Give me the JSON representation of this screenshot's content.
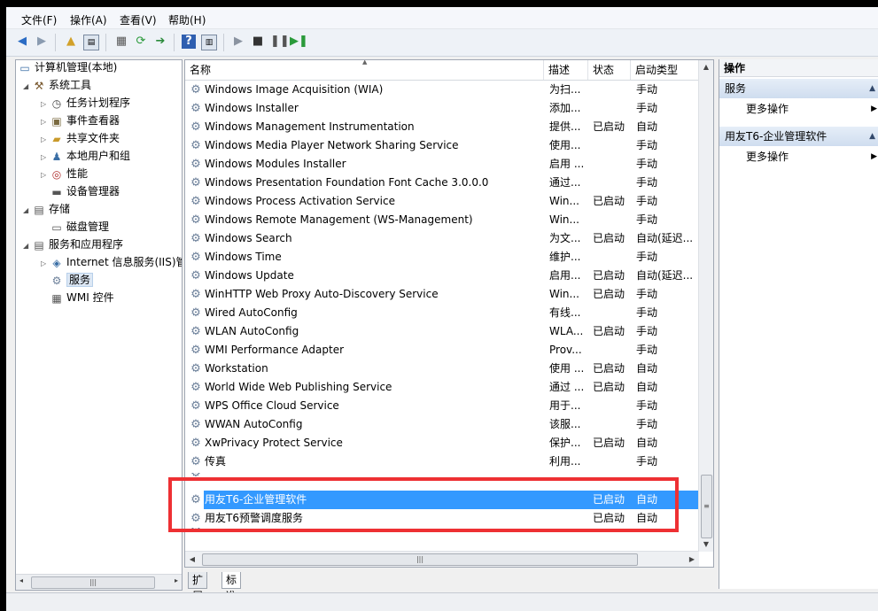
{
  "menu": [
    "文件(F)",
    "操作(A)",
    "查看(V)",
    "帮助(H)"
  ],
  "tree": {
    "items": [
      {
        "label": "计算机管理(本地)",
        "icon": "computer-icon"
      },
      {
        "label": "系统工具",
        "icon": "tools-icon"
      },
      {
        "label": "任务计划程序",
        "icon": "clock-icon"
      },
      {
        "label": "事件查看器",
        "icon": "event-icon"
      },
      {
        "label": "共享文件夹",
        "icon": "folder-icon"
      },
      {
        "label": "本地用户和组",
        "icon": "users-icon"
      },
      {
        "label": "性能",
        "icon": "performance-icon"
      },
      {
        "label": "设备管理器",
        "icon": "device-icon"
      },
      {
        "label": "存储",
        "icon": "storage-icon"
      },
      {
        "label": "磁盘管理",
        "icon": "disk-icon"
      },
      {
        "label": "服务和应用程序",
        "icon": "services-apps-icon"
      },
      {
        "label": "Internet 信息服务(IIS)管",
        "icon": "iis-icon"
      },
      {
        "label": "服务",
        "icon": "gear-icon"
      },
      {
        "label": "WMI 控件",
        "icon": "wmi-icon"
      }
    ]
  },
  "list": {
    "columns": [
      "名称",
      "描述",
      "状态",
      "启动类型"
    ],
    "rows": [
      {
        "name": "Windows Image Acquisition (WIA)",
        "desc": "为扫...",
        "status": "",
        "startup": "手动"
      },
      {
        "name": "Windows Installer",
        "desc": "添加...",
        "status": "",
        "startup": "手动"
      },
      {
        "name": "Windows Management Instrumentation",
        "desc": "提供...",
        "status": "已启动",
        "startup": "自动"
      },
      {
        "name": "Windows Media Player Network Sharing Service",
        "desc": "使用...",
        "status": "",
        "startup": "手动"
      },
      {
        "name": "Windows Modules Installer",
        "desc": "启用 ...",
        "status": "",
        "startup": "手动"
      },
      {
        "name": "Windows Presentation Foundation Font Cache 3.0.0.0",
        "desc": "通过...",
        "status": "",
        "startup": "手动"
      },
      {
        "name": "Windows Process Activation Service",
        "desc": "Win...",
        "status": "已启动",
        "startup": "手动"
      },
      {
        "name": "Windows Remote Management (WS-Management)",
        "desc": "Win...",
        "status": "",
        "startup": "手动"
      },
      {
        "name": "Windows Search",
        "desc": "为文...",
        "status": "已启动",
        "startup": "自动(延迟..."
      },
      {
        "name": "Windows Time",
        "desc": "维护...",
        "status": "",
        "startup": "手动"
      },
      {
        "name": "Windows Update",
        "desc": "启用...",
        "status": "已启动",
        "startup": "自动(延迟..."
      },
      {
        "name": "WinHTTP Web Proxy Auto-Discovery Service",
        "desc": "Win...",
        "status": "已启动",
        "startup": "手动"
      },
      {
        "name": "Wired AutoConfig",
        "desc": "有线...",
        "status": "",
        "startup": "手动"
      },
      {
        "name": "WLAN AutoConfig",
        "desc": "WLA...",
        "status": "已启动",
        "startup": "手动"
      },
      {
        "name": "WMI Performance Adapter",
        "desc": "Prov...",
        "status": "",
        "startup": "手动"
      },
      {
        "name": "Workstation",
        "desc": "使用 ...",
        "status": "已启动",
        "startup": "自动"
      },
      {
        "name": "World Wide Web Publishing Service",
        "desc": "通过 ...",
        "status": "已启动",
        "startup": "自动"
      },
      {
        "name": "WPS Office Cloud Service",
        "desc": "用于...",
        "status": "",
        "startup": "手动"
      },
      {
        "name": "WWAN AutoConfig",
        "desc": "该服...",
        "status": "",
        "startup": "手动"
      },
      {
        "name": "XwPrivacy Protect Service",
        "desc": "保护...",
        "status": "已启动",
        "startup": "自动"
      },
      {
        "name": "传真",
        "desc": "利用...",
        "status": "",
        "startup": "手动"
      }
    ],
    "selected_row": {
      "name": "用友T6-企业管理软件",
      "status": "已启动",
      "startup": "自动"
    },
    "next_row": {
      "name": "用友T6预警调度服务",
      "status": "已启动",
      "startup": "自动"
    }
  },
  "tabs": [
    "扩展",
    "标准"
  ],
  "actions": {
    "title": "操作",
    "groups": [
      {
        "title": "服务",
        "item": "更多操作"
      },
      {
        "title": "用友T6-企业管理软件",
        "item": "更多操作"
      }
    ]
  }
}
